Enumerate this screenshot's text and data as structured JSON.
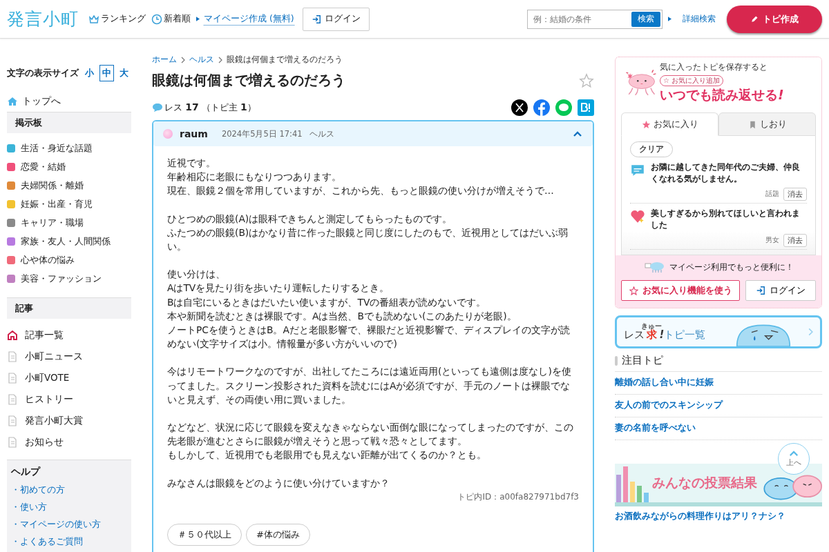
{
  "header": {
    "logo": "発言小町",
    "nav": [
      {
        "kind": "ranking",
        "label": "ランキング"
      },
      {
        "kind": "new",
        "label": "新着順"
      },
      {
        "kind": "link",
        "label": "マイページ作成 (無料)"
      }
    ],
    "login": "ログイン",
    "search": {
      "placeholder": "例：結婚の条件",
      "button": "検索"
    },
    "advanced": "詳細検索",
    "create": "トピ作成"
  },
  "sidebar": {
    "size_label": "文字の表示サイズ",
    "sizes": [
      {
        "label": "小",
        "selected": false
      },
      {
        "label": "中",
        "selected": true
      },
      {
        "label": "大",
        "selected": false
      }
    ],
    "top": "トップへ",
    "board_title": "掲示板",
    "boards": [
      {
        "label": "生活・身近な話題",
        "color": "#3bb4d8"
      },
      {
        "label": "恋愛・結婚",
        "color": "#f0507a"
      },
      {
        "label": "夫婦関係・離婚",
        "color": "#e08a3a"
      },
      {
        "label": "妊娠・出産・育児",
        "color": "#f2c230"
      },
      {
        "label": "キャリア・職場",
        "color": "#8a8a8a"
      },
      {
        "label": "家族・友人・人間関係",
        "color": "#b77ae0"
      },
      {
        "label": "心や体の悩み",
        "color": "#f06a7a"
      },
      {
        "label": "美容・ファッション",
        "color": "#c080c0"
      }
    ],
    "article_title": "記事",
    "articles": [
      {
        "kind": "home",
        "label": "記事一覧"
      },
      {
        "kind": "doc",
        "label": "小町ニュース"
      },
      {
        "kind": "doc",
        "label": "小町VOTE"
      },
      {
        "kind": "doc",
        "label": "ヒストリー"
      },
      {
        "kind": "doc",
        "label": "発言小町大賞"
      },
      {
        "kind": "doc",
        "label": "お知らせ"
      }
    ],
    "help_title": "ヘルプ",
    "help": [
      "・初めての方",
      "・使い方",
      "・マイページの使い方",
      "・よくあるご質問"
    ]
  },
  "breadcrumb": [
    {
      "label": "ホーム",
      "link": true
    },
    {
      "label": "ヘルス",
      "link": true
    },
    {
      "label": "眼鏡は何個まで増えるのだろう",
      "link": false
    }
  ],
  "title": "眼鏡は何個まで増えるのだろう",
  "res": {
    "label": "レス",
    "count": "17",
    "owner_label": "（トピ主",
    "owner_count": "1",
    "close": "）"
  },
  "post": {
    "author": "raum",
    "date": "2024年5月5日 17:41",
    "category": "ヘルス",
    "expanded": true,
    "paragraphs": [
      [
        "近視です。",
        "年齢相応に老眼にもなりつつあります。",
        "現在、眼鏡２個を常用していますが、これから先、もっと眼鏡の使い分けが増えそうで…"
      ],
      [
        "ひとつめの眼鏡(A)は眼科できちんと測定してもらったものです。",
        "ふたつめの眼鏡(B)はかなり昔に作った眼鏡と同じ度にしたのもで、近視用としてはだいぶ弱い。"
      ],
      [
        "使い分けは、",
        "AはTVを見たり街を歩いたり運転したりするとき。",
        "Bは自宅にいるときはだいたい使いますが、TVの番組表が読めないです。",
        "本や新聞を読むときは裸眼です。Aは当然、Bでも読めない(このあたりが老眼)。",
        "ノートPCを使うときはB。Aだと老眼影響で、裸眼だと近視影響で、ディスプレイの文字が読めない(文字サイズは小。情報量が多い方がいいので)"
      ],
      [
        "今はリモートワークなのですが、出社してたころには遠近両用(といっても遠側は度なし)を使ってました。スクリーン投影された資料を読むにはAが必須ですが、手元のノートは裸眼でないと見えず、その両使い用に買いました。"
      ],
      [
        "などなど、状況に応じて眼鏡を変えなきゃならない面倒な眼になってしまったのですが、この先老眼が進むとさらに眼鏡が増えそうと思って戦々恐々としてます。",
        "もしかして、近視用でも老眼用でも見えない距離が出てくるのか？とも。"
      ],
      [
        "みなさんは眼鏡をどのように使い分けていますか？"
      ]
    ],
    "topic_id": "トピ内ID：a00fa827971bd7f3",
    "tags": [
      "＃５０代以上",
      "#体の悩み"
    ]
  },
  "promo": {
    "lead": "気に入ったトピを保存すると",
    "pill": "☆ お気に入り追加",
    "headline": "いつでも読み返せる",
    "bang": "!",
    "tabs": [
      {
        "kind": "star",
        "label": "お気に入り",
        "selected": true
      },
      {
        "kind": "bookmark",
        "label": "しおり",
        "selected": false
      }
    ],
    "clear": "クリア",
    "items": [
      {
        "kind": "chat",
        "title": "お隣に越してきた同年代のご夫婦、仲良くなれる気がしません。",
        "category": "話題",
        "remove": "消去"
      },
      {
        "kind": "heart",
        "title": "美しすぎるから別れてほしいと言われました",
        "category": "男女",
        "remove": "消去"
      }
    ],
    "note": "マイページ利用でもっと便利に！",
    "use_button": "お気に入り機能を使う",
    "login": "ログイン"
  },
  "res_banner": {
    "pre": "レス",
    "ruby_base": "求",
    "ruby": "きゅー",
    "bang": "!",
    "post": "トピ一覧"
  },
  "featured": {
    "title": "注目トピ",
    "items": [
      "離婚の話し合い中に妊娠",
      "友人の前でのスキンシップ",
      "妻の名前を呼べない"
    ]
  },
  "to_top": "上へ",
  "vote_banner": {
    "text": "みんなの投票結果"
  },
  "vote_caption": "お酒飲みながらの料理作りはアリ？ナシ？"
}
